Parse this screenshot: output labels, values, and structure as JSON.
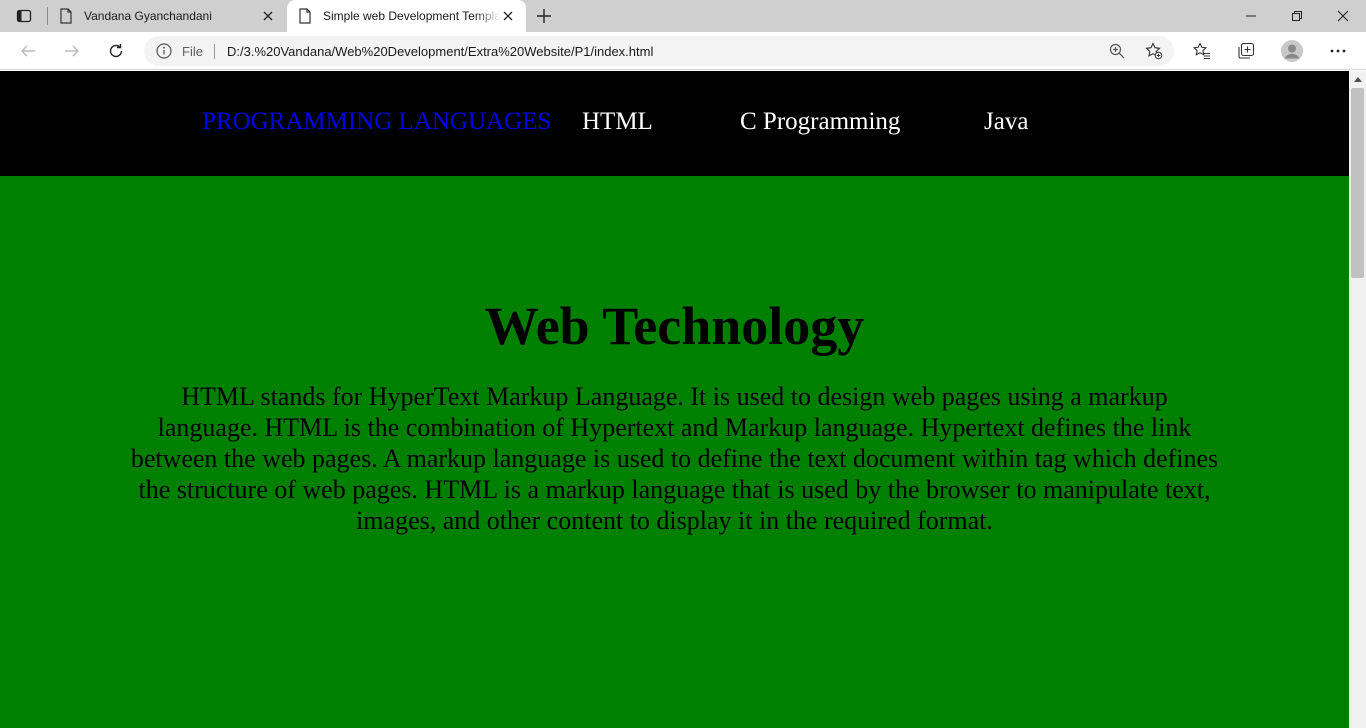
{
  "browser": {
    "tabs": [
      {
        "title": "Vandana Gyanchandani",
        "active": false
      },
      {
        "title": "Simple web Development Template",
        "active": true
      }
    ],
    "address": {
      "scheme_label": "File",
      "url": "D:/3.%20Vandana/Web%20Development/Extra%20Website/P1/index.html"
    },
    "icons": {
      "tab_actions": "tab-actions-icon",
      "page": "page-icon",
      "close": "close-icon",
      "new_tab": "plus-icon",
      "minimize": "minimize-icon",
      "restore": "restore-icon",
      "window_close": "close-icon",
      "back": "back-arrow-icon",
      "forward": "forward-arrow-icon",
      "refresh": "refresh-icon",
      "info": "info-icon",
      "zoom": "zoom-icon",
      "add_favorite": "star-add-icon",
      "favorites": "favorites-icon",
      "collections": "collections-icon",
      "profile": "profile-icon",
      "more": "more-icon"
    }
  },
  "page": {
    "nav": {
      "brand": "PROGRAMMING LANGUAGES",
      "links": [
        "HTML",
        "C Programming",
        "Java"
      ]
    },
    "hero": {
      "title": "Web Technology",
      "text": "HTML stands for HyperText Markup Language. It is used to design web pages using a markup language. HTML is the combination of Hypertext and Markup language. Hypertext defines the link between the web pages. A markup language is used to define the text document within tag which defines the structure of web pages. HTML is a markup language that is used by the browser to manipulate text, images, and other content to display it in the required format."
    },
    "colors": {
      "nav_bg": "#000000",
      "brand_link": "#0000ee",
      "nav_link": "#ffffff",
      "page_bg": "#008000",
      "text": "#000000"
    }
  }
}
